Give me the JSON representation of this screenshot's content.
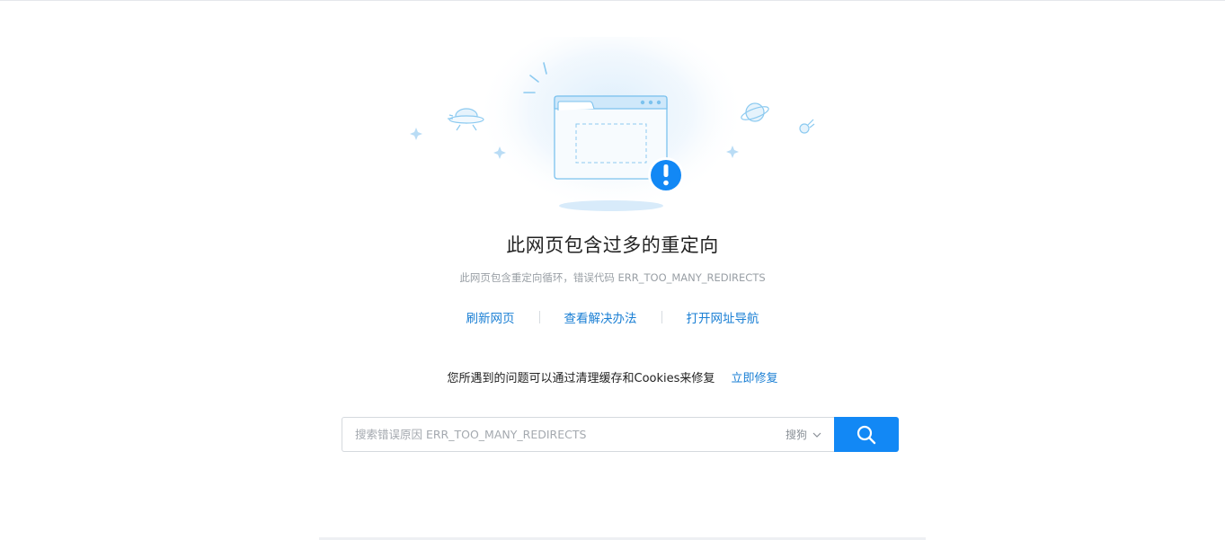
{
  "error": {
    "title": "此网页包含过多的重定向",
    "subtitle": "此网页包含重定向循环，错误代码 ERR_TOO_MANY_REDIRECTS"
  },
  "actions": {
    "refresh": "刷新网页",
    "view_solution": "查看解决办法",
    "open_nav": "打开网址导航"
  },
  "fix": {
    "message": "您所遇到的问题可以通过清理缓存和Cookies来修复",
    "link": "立即修复"
  },
  "search": {
    "placeholder": "搜索错误原因 ERR_TOO_MANY_REDIRECTS",
    "value": "",
    "engine": "搜狗"
  },
  "icons": {
    "alert": "exclamation-badge-icon",
    "search": "search-icon",
    "dropdown": "chevron-down-icon"
  },
  "colors": {
    "accent": "#1288f5",
    "link": "#1a7fd4",
    "illustration": "#7cc2ee"
  }
}
